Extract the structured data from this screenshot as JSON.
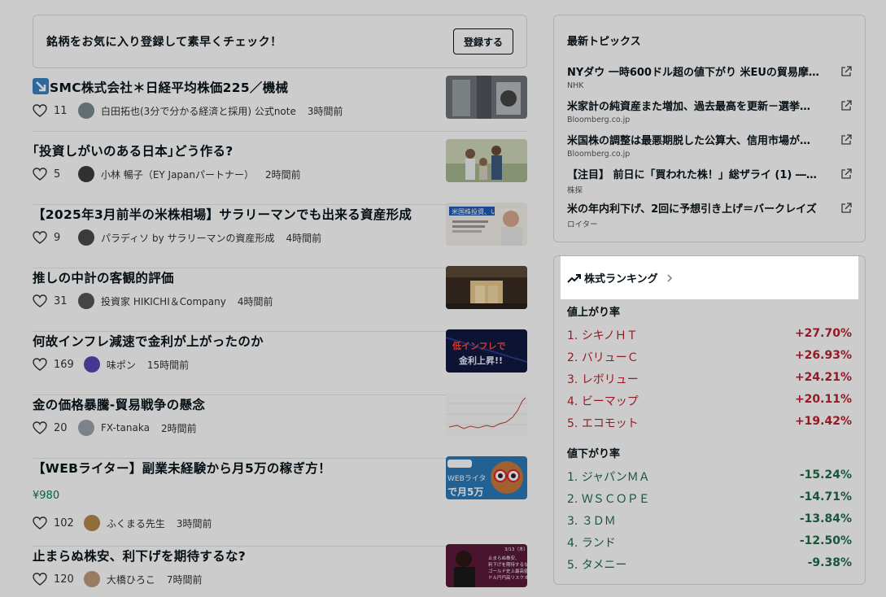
{
  "cta": {
    "text": "銘柄をお気に入り登録して素早くチェック！",
    "button": "登録する"
  },
  "articles": [
    {
      "title": "SMC株式会社＊日経平均株価225／機械",
      "likes": "11",
      "author": "白田拓也(3分で分かる経済と採用) 公式note",
      "time": "3時間前",
      "avatar_color": "#7a8b8f",
      "thumb": "machine",
      "badge_icon": "chart-down-icon"
    },
    {
      "title": "｢投資しがいのある日本｣どう作る?",
      "likes": "5",
      "author": "小林 暢子（EY Japanパートナー）",
      "time": "2時間前",
      "avatar_color": "#3d3d3d",
      "thumb": "family"
    },
    {
      "title": "【2025年3月前半の米株相場】サラリーマンでも出来る資産形成",
      "likes": "9",
      "author": "パラディソ by サラリーマンの資産形成",
      "time": "4時間前",
      "avatar_color": "#4a4a4a",
      "thumb": "person"
    },
    {
      "title": "推しの中計の客観的評価",
      "likes": "31",
      "author": "投資家 HIKICHI＆Company",
      "time": "4時間前",
      "avatar_color": "#555555",
      "thumb": "building"
    },
    {
      "title": "何故インフレ減速で金利が上がったのか",
      "likes": "169",
      "author": "味ポン",
      "time": "15時間前",
      "avatar_color": "#5548b5",
      "thumb": "neon"
    },
    {
      "title": "金の価格暴騰-貿易戦争の懸念",
      "likes": "20",
      "author": "FX-tanaka",
      "time": "2時間前",
      "avatar_color": "#9aa3b0",
      "thumb": "chart"
    },
    {
      "title": "【WEBライター】副業未経験から月5万の稼ぎ方！",
      "price": "¥980",
      "likes": "102",
      "author": "ふくまる先生",
      "time": "3時間前",
      "avatar_color": "#b58a4c",
      "thumb": "owl"
    },
    {
      "title": "止まらぬ株安、利下げを期待するな?",
      "likes": "120",
      "author": "大橋ひろこ",
      "time": "7時間前",
      "avatar_color": "#c09a7a",
      "thumb": "news"
    }
  ],
  "thumb_text": {
    "person": "米国株投資、いつまで？",
    "neon": "低インフレで金利上昇!!",
    "owl": "WEBライター で月5万",
    "news_date": "3/13（木）",
    "news_lines": [
      "止まらぬ株安、",
      "利下げを期待するな？",
      "ゴールド史上最高値更新",
      "ドル円円高リスクオフ続く"
    ]
  },
  "topics": {
    "title": "最新トピックス",
    "items": [
      {
        "headline": "NYダウ 一時600ドル超の値下がり 米EUの貿易摩…",
        "source": "NHK"
      },
      {
        "headline": "米家計の純資産また増加、過去最高を更新－選挙…",
        "source": "Bloomberg.co.jp"
      },
      {
        "headline": "米国株の調整は最悪期脱した公算大、信用市場が…",
        "source": "Bloomberg.co.jp"
      },
      {
        "headline": "【注目】 前日に「買われた株！」総ザライ (1) ―…",
        "source": "株探"
      },
      {
        "headline": "米の年内利下げ、2回に予想引き上げ＝バークレイズ",
        "source": "ロイター"
      }
    ]
  },
  "ranking": {
    "title": "株式ランキング",
    "up_title": "値上がり率",
    "down_title": "値下がり率",
    "up": [
      {
        "rank": "1.",
        "name": "シキノＨＴ",
        "pct": "+27.70%"
      },
      {
        "rank": "2.",
        "name": "バリューＣ",
        "pct": "+26.93%"
      },
      {
        "rank": "3.",
        "name": "レボリュー",
        "pct": "+24.21%"
      },
      {
        "rank": "4.",
        "name": "ビーマップ",
        "pct": "+20.11%"
      },
      {
        "rank": "5.",
        "name": "エコモット",
        "pct": "+19.42%"
      }
    ],
    "down": [
      {
        "rank": "1.",
        "name": "ジャパンＭＡ",
        "pct": "-15.24%"
      },
      {
        "rank": "2.",
        "name": "ＷＳＣＯＰＥ",
        "pct": "-14.71%"
      },
      {
        "rank": "3.",
        "name": "３ＤＭ",
        "pct": "-13.84%"
      },
      {
        "rank": "4.",
        "name": "ランド",
        "pct": "-12.50%"
      },
      {
        "rank": "5.",
        "name": "タメニー",
        "pct": "-9.38%"
      }
    ]
  }
}
